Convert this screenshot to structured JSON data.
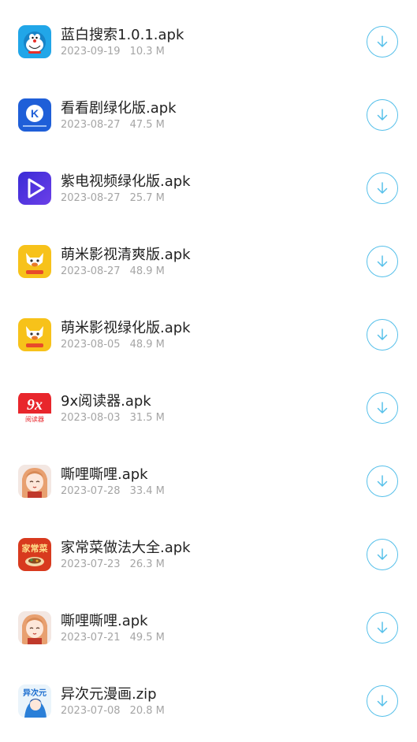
{
  "files": [
    {
      "name": "蓝白搜索1.0.1.apk",
      "date": "2023-09-19",
      "size": "10.3 M",
      "icon": "doraemon-app-icon"
    },
    {
      "name": "看看剧绿化版.apk",
      "date": "2023-08-27",
      "size": "47.5 M",
      "icon": "kankan-k-app-icon"
    },
    {
      "name": "紫电视频绿化版.apk",
      "date": "2023-08-27",
      "size": "25.7 M",
      "icon": "purple-play-app-icon"
    },
    {
      "name": "萌米影视清爽版.apk",
      "date": "2023-08-27",
      "size": "48.9 M",
      "icon": "mengmi-app-icon"
    },
    {
      "name": "萌米影视绿化版.apk",
      "date": "2023-08-05",
      "size": "48.9 M",
      "icon": "mengmi-app-icon"
    },
    {
      "name": "9x阅读器.apk",
      "date": "2023-08-03",
      "size": "31.5 M",
      "icon": "9x-reader-app-icon"
    },
    {
      "name": "嘶哩嘶哩.apk",
      "date": "2023-07-28",
      "size": "33.4 M",
      "icon": "anime-girl-app-icon"
    },
    {
      "name": "家常菜做法大全.apk",
      "date": "2023-07-23",
      "size": "26.3 M",
      "icon": "home-cooking-app-icon"
    },
    {
      "name": "嘶哩嘶哩.apk",
      "date": "2023-07-21",
      "size": "49.5 M",
      "icon": "anime-girl-app-icon"
    },
    {
      "name": "异次元漫画.zip",
      "date": "2023-07-08",
      "size": "20.8 M",
      "icon": "yiciyuan-comic-app-icon"
    }
  ],
  "icon_labels": {
    "kankan_letter": "K",
    "nineX_main": "9x",
    "nineX_sub": "阅读器",
    "cooking": "家常菜",
    "yiciyuan": "异次元"
  },
  "colors": {
    "accent": "#56c0ea",
    "title": "#222222",
    "meta": "#a5a5a5",
    "background": "#ffffff"
  }
}
